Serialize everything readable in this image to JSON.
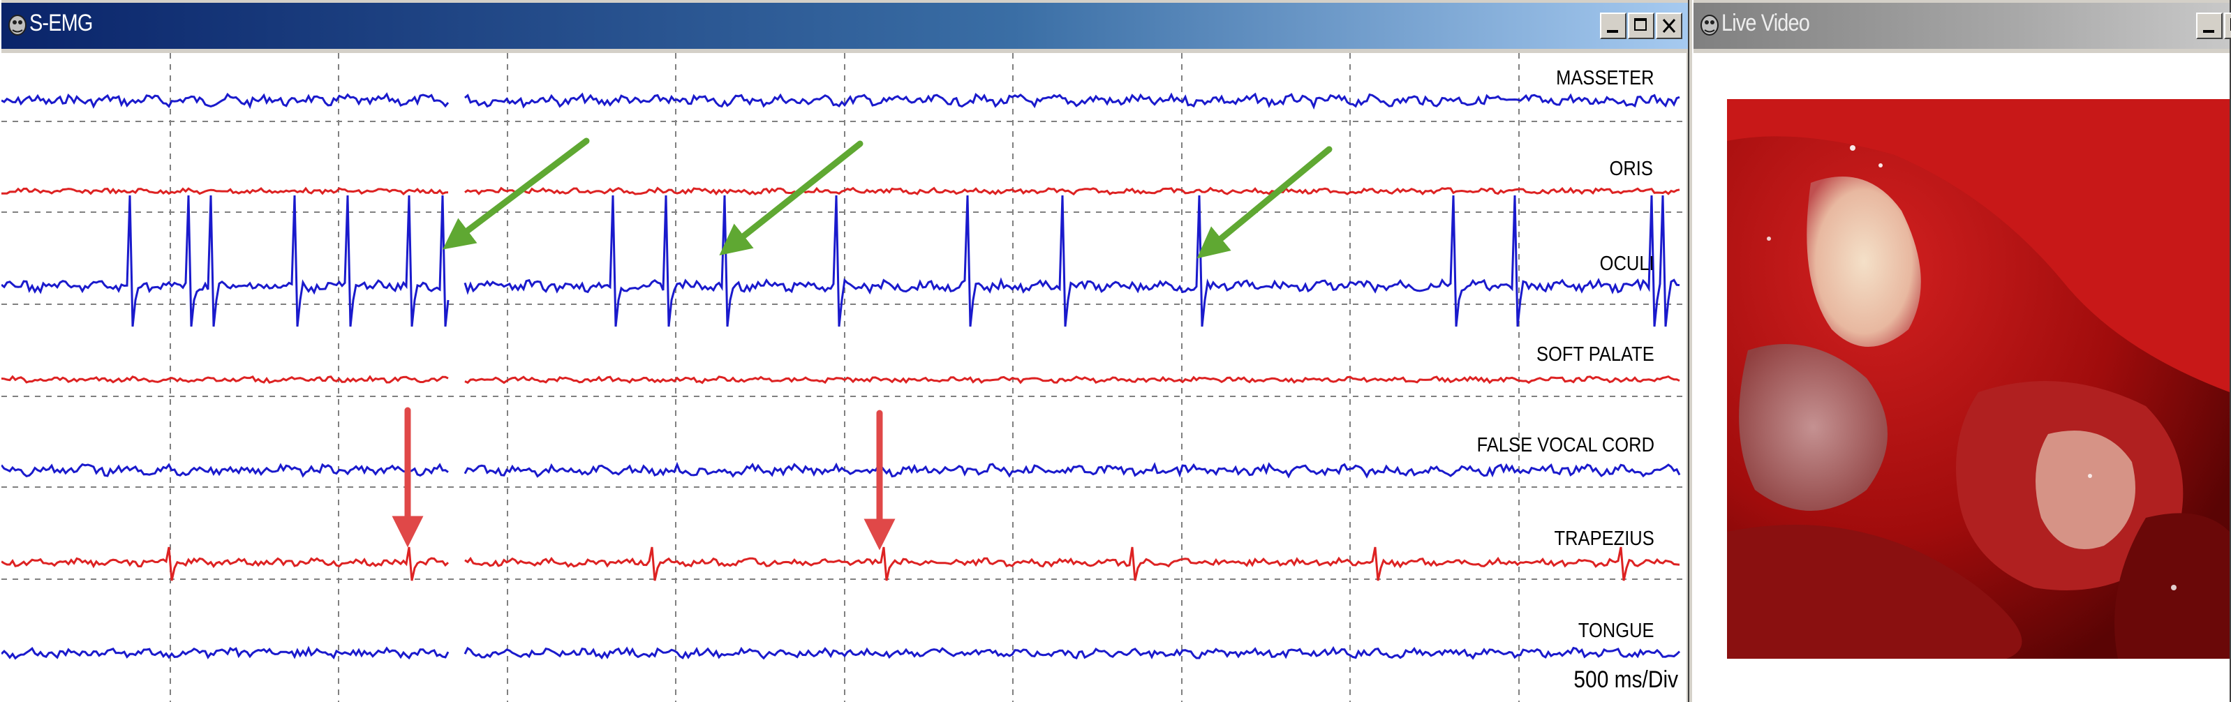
{
  "emg_window": {
    "title": "S-EMG",
    "scale_label": "500 ms/Div",
    "channels": [
      {
        "name": "MASSETER",
        "color": "#1a1acc"
      },
      {
        "name": "ORIS",
        "color": "#dd2222"
      },
      {
        "name": "OCULI",
        "color": "#1a1acc"
      },
      {
        "name": "SOFT PALATE",
        "color": "#dd2222"
      },
      {
        "name": "FALSE VOCAL CORD",
        "color": "#1a1acc"
      },
      {
        "name": "TRAPEZIUS",
        "color": "#dd2222"
      },
      {
        "name": "TONGUE",
        "color": "#1a1acc"
      }
    ],
    "annotations": {
      "green_arrow_color": "#5fa832",
      "red_arrow_color": "#e04848"
    }
  },
  "video_window": {
    "title": "Live Video"
  },
  "colors": {
    "active_titlebar": "#0a246a",
    "inactive_titlebar": "#808080"
  }
}
